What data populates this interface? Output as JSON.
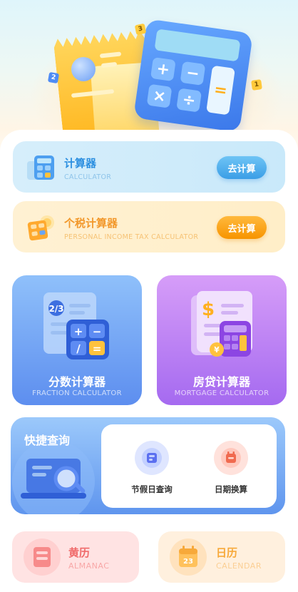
{
  "hero": {
    "keys": {
      "plus": "+",
      "minus": "−",
      "times": "×",
      "divide": "÷",
      "equals": "="
    },
    "cubes": [
      "3",
      "2",
      "1"
    ]
  },
  "calculator_card": {
    "title": "计算器",
    "subtitle": "CALCULATOR",
    "button": "去计算"
  },
  "tax_card": {
    "title": "个税计算器",
    "subtitle": "PERSONAL INCOME TAX CALCULATOR",
    "button": "去计算"
  },
  "fraction_card": {
    "title": "分数计算器",
    "subtitle": "FRACTION CALCULATOR",
    "fraction_label": "2/3",
    "keys": {
      "plus": "+",
      "minus": "−",
      "slash": "/",
      "equals": "="
    }
  },
  "mortgage_card": {
    "title": "房贷计算器",
    "subtitle": "MORTGAGE CALCULATOR",
    "currency": "$",
    "yen": "¥"
  },
  "quick_query": {
    "title": "快捷查询",
    "items": [
      {
        "label": "节假日查询"
      },
      {
        "label": "日期换算"
      }
    ]
  },
  "almanac_card": {
    "title": "黄历",
    "subtitle": "ALMANAC"
  },
  "calendar_card": {
    "title": "日历",
    "subtitle": "CALENDAR",
    "day": "23"
  },
  "colors": {
    "calculator_accent": "#2c8fe0",
    "tax_accent": "#f2982b",
    "fraction_bg": "#5d8eef",
    "mortgage_bg": "#a56af0",
    "quick_bg": "#5f95ee",
    "almanac_accent": "#f06a6a",
    "calendar_accent": "#f7b34a"
  }
}
